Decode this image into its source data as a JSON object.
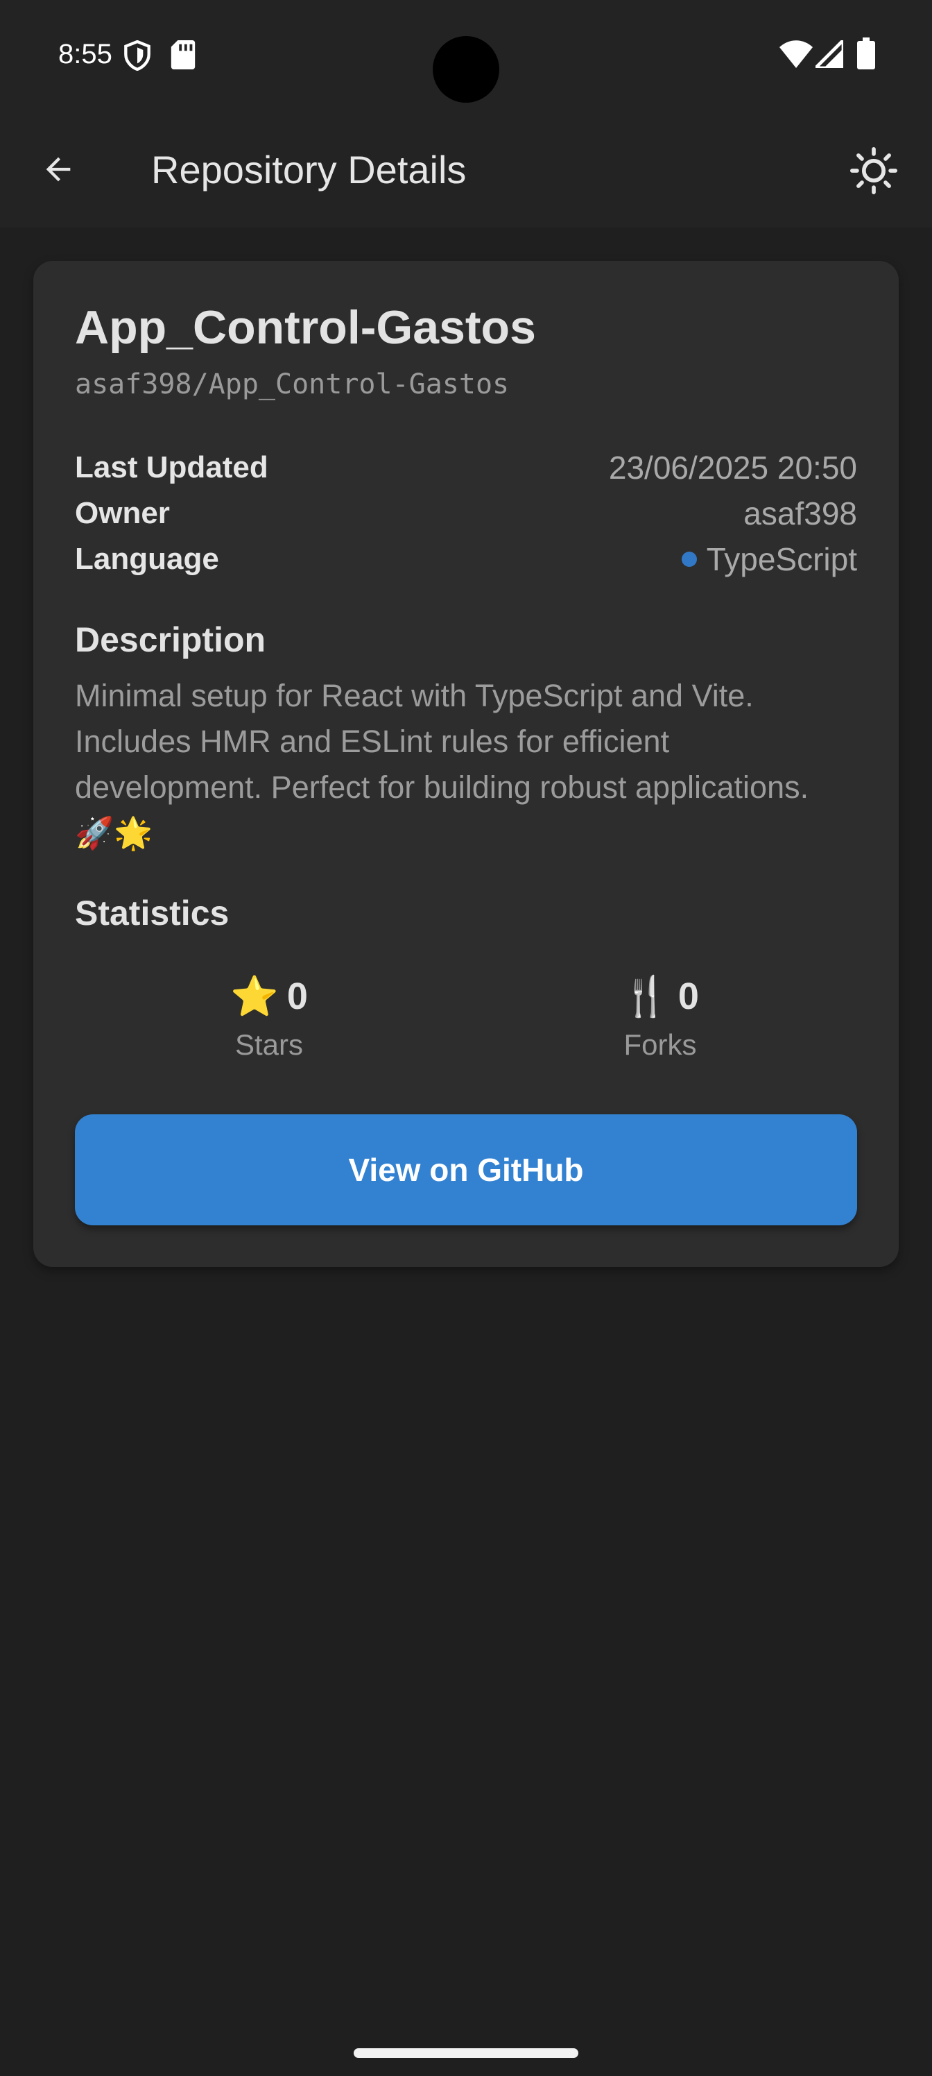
{
  "status_bar": {
    "time": "8:55"
  },
  "app_bar": {
    "title": "Repository Details"
  },
  "repo": {
    "name": "App_Control-Gastos",
    "full_name": "asaf398/App_Control-Gastos",
    "details": [
      {
        "label": "Last Updated",
        "value": "23/06/2025 20:50"
      },
      {
        "label": "Owner",
        "value": "asaf398"
      },
      {
        "label": "Language",
        "value": "TypeScript"
      }
    ],
    "language_color": "#3178c6",
    "description_heading": "Description",
    "description": "Minimal setup for React with TypeScript and Vite. Includes HMR and ESLint rules for efficient development. Perfect for building robust applications. 🚀🌟",
    "statistics_heading": "Statistics",
    "stats": {
      "stars": {
        "icon": "⭐",
        "value": "0",
        "label": "Stars"
      },
      "forks": {
        "icon": "🍴",
        "value": "0",
        "label": "Forks"
      }
    },
    "github_button": "View on GitHub"
  },
  "colors": {
    "accent": "#3282d1",
    "background": "#1f1f1f",
    "card": "#2d2d2d"
  }
}
